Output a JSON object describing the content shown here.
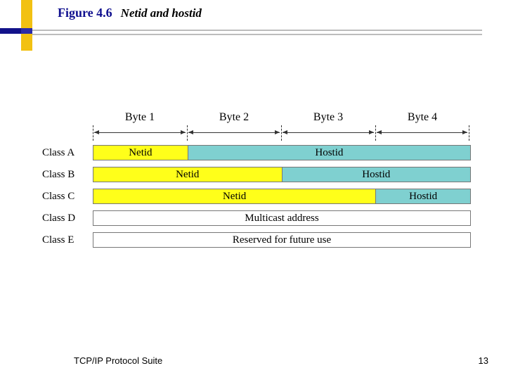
{
  "figure": {
    "number": "Figure 4.6",
    "title": "Netid and hostid"
  },
  "bytes": {
    "b1": "Byte 1",
    "b2": "Byte 2",
    "b3": "Byte 3",
    "b4": "Byte 4"
  },
  "rows": {
    "classA": {
      "label": "Class A",
      "netid": "Netid",
      "hostid": "Hostid"
    },
    "classB": {
      "label": "Class B",
      "netid": "Netid",
      "hostid": "Hostid"
    },
    "classC": {
      "label": "Class C",
      "netid": "Netid",
      "hostid": "Hostid"
    },
    "classD": {
      "label": "Class D",
      "value": "Multicast address"
    },
    "classE": {
      "label": "Class E",
      "value": "Reserved for future use"
    }
  },
  "footer": {
    "text": "TCP/IP Protocol Suite",
    "page": "13"
  },
  "colors": {
    "netid": "#ffff1a",
    "hostid": "#7fd0d0",
    "accent_blue": "#12128a",
    "accent_yellow": "#f2c112"
  },
  "chart_data": {
    "type": "table",
    "title": "Netid and hostid",
    "columns": [
      "Byte 1",
      "Byte 2",
      "Byte 3",
      "Byte 4"
    ],
    "series": [
      {
        "name": "Class A",
        "segments": [
          {
            "label": "Netid",
            "bytes": 1
          },
          {
            "label": "Hostid",
            "bytes": 3
          }
        ]
      },
      {
        "name": "Class B",
        "segments": [
          {
            "label": "Netid",
            "bytes": 2
          },
          {
            "label": "Hostid",
            "bytes": 2
          }
        ]
      },
      {
        "name": "Class C",
        "segments": [
          {
            "label": "Netid",
            "bytes": 3
          },
          {
            "label": "Hostid",
            "bytes": 1
          }
        ]
      },
      {
        "name": "Class D",
        "segments": [
          {
            "label": "Multicast address",
            "bytes": 4
          }
        ]
      },
      {
        "name": "Class E",
        "segments": [
          {
            "label": "Reserved for future use",
            "bytes": 4
          }
        ]
      }
    ]
  }
}
